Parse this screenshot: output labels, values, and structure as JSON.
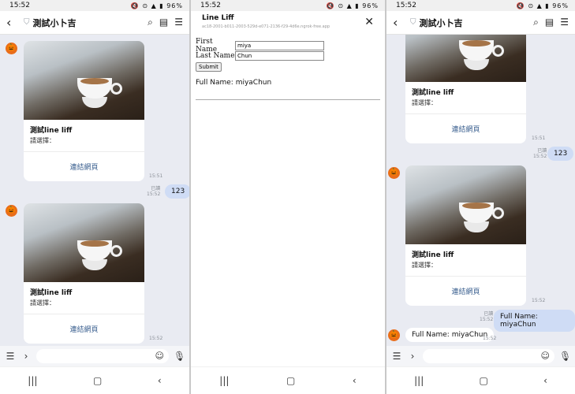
{
  "status": {
    "time": "15:52",
    "battery": "96%",
    "icons": "🔇 ⊙ ▲ ▮"
  },
  "chat": {
    "title": "測試小卜吉",
    "card": {
      "title": "測試line liff",
      "subtitle": "請選擇：",
      "link": "連結網頁"
    },
    "my_message": "123",
    "read_label": "已讀",
    "full_name_message": "Full Name: miyaChun",
    "times": {
      "t1551": "15:51",
      "t1552": "15:52"
    }
  },
  "liff": {
    "title": "Line Liff",
    "url": "ac18-2001-b011-2003-529d-e071-2136-f29-4d6e.ngrok-free.app",
    "first_name_label": "First Name",
    "first_name_value": "miya",
    "last_name_label": "Last Name",
    "last_name_value": "Chun",
    "submit_label": "Submit",
    "full_name": "Full Name: miyaChun"
  },
  "icons": {
    "back": "back-arrow-icon",
    "shield": "shield-icon",
    "search": "search-icon",
    "notes": "notes-icon",
    "menu": "menu-icon",
    "avatar": "pumpkin-avatar-icon",
    "close": "close-icon"
  }
}
